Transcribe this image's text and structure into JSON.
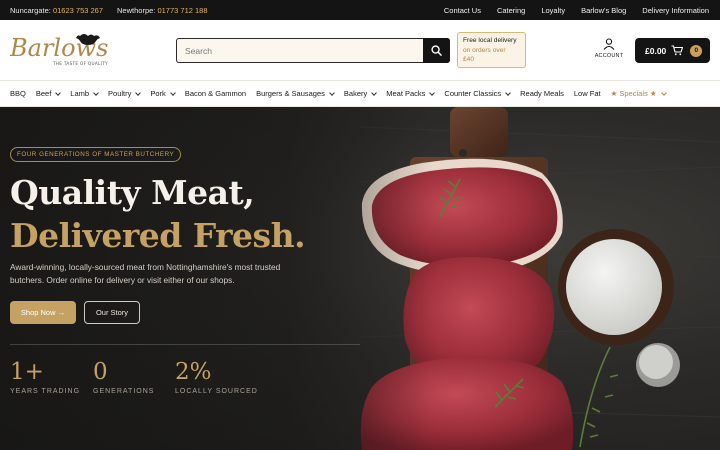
{
  "topbar": {
    "nuncargate_label": "Nuncargate:",
    "nuncargate_phone": "01623 753 267",
    "newthorpe_label": "Newthorpe:",
    "newthorpe_phone": "01773 712 188",
    "links": [
      "Contact Us",
      "Catering",
      "Loyalty",
      "Barlow's Blog",
      "Delivery Information"
    ]
  },
  "brand": {
    "name": "Barlows",
    "tagline": "THE TASTE OF QUALITY",
    "gold": "#c6a164",
    "dark": "#141414"
  },
  "search": {
    "placeholder": "Search",
    "icon": "search-icon"
  },
  "delivery_promo": {
    "line1": "Free local delivery",
    "line2": "on orders over",
    "line3": "£40"
  },
  "account": {
    "label": "ACCOUNT",
    "icon": "user-icon"
  },
  "cart": {
    "total": "£0.00",
    "count": "0",
    "icon": "cart-icon"
  },
  "nav": [
    {
      "label": "BBQ",
      "dropdown": false
    },
    {
      "label": "Beef",
      "dropdown": true
    },
    {
      "label": "Lamb",
      "dropdown": true
    },
    {
      "label": "Poultry",
      "dropdown": true
    },
    {
      "label": "Pork",
      "dropdown": true
    },
    {
      "label": "Bacon & Gammon",
      "dropdown": false
    },
    {
      "label": "Burgers & Sausages",
      "dropdown": true
    },
    {
      "label": "Bakery",
      "dropdown": true
    },
    {
      "label": "Meat Packs",
      "dropdown": true
    },
    {
      "label": "Counter Classics",
      "dropdown": true
    },
    {
      "label": "Ready Meals",
      "dropdown": false
    },
    {
      "label": "Low Fat",
      "dropdown": false
    },
    {
      "label": "★ Specials ★",
      "dropdown": true
    }
  ],
  "hero": {
    "badge": "FOUR GENERATIONS OF MASTER BUTCHERY",
    "headline_1": "Quality Meat,",
    "headline_2": "Delivered Fresh.",
    "lead": "Award-winning, locally-sourced meat from Nottinghamshire's most trusted butchers. Order online for delivery or visit either of our shops.",
    "primary_cta": "Shop Now →",
    "secondary_cta": "Our Story",
    "stats": [
      {
        "value": "1+",
        "label": "YEARS TRADING"
      },
      {
        "value": "0",
        "label": "GENERATIONS"
      },
      {
        "value": "2%",
        "label": "LOCALLY SOURCED"
      }
    ]
  }
}
